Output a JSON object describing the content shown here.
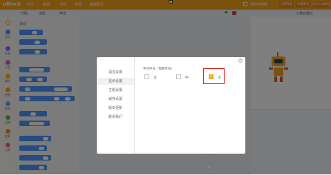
{
  "app": {
    "logo_text": "uBlock"
  },
  "topbar": {
    "menus": [
      "文件",
      "编辑",
      "项目",
      "教程",
      "编程模式"
    ],
    "save_cloud_label": "保存到电脑",
    "login_label": "立即登录",
    "register_label": "注册账号",
    "python_label": "Python编程"
  },
  "tabs": {
    "code": "代码",
    "costume": "造型",
    "sound": "声音"
  },
  "categories": [
    {
      "label": "运动",
      "color": "#4c97ff"
    },
    {
      "label": "外观",
      "color": "#9966ff"
    },
    {
      "label": "声音",
      "color": "#cf63cf"
    },
    {
      "label": "事件",
      "color": "#ffbf00"
    },
    {
      "label": "控制",
      "color": "#ffab19"
    },
    {
      "label": "侦测",
      "color": "#5cb1d6"
    },
    {
      "label": "运算",
      "color": "#59c059"
    },
    {
      "label": "变量",
      "color": "#ff8c1a"
    },
    {
      "label": "自制",
      "color": "#ff6680"
    }
  ],
  "palette": {
    "heading": "运动"
  },
  "stage": {
    "display_mode_label": "小舞台模式"
  },
  "dialog": {
    "menu": [
      "语言设置",
      "显示设置",
      "主题设置",
      "缓存设置",
      "版本更新",
      "联系我们"
    ],
    "active_index": 1,
    "section_title": "字体字号（需要生效）",
    "options": [
      {
        "label": "大",
        "checked": false
      },
      {
        "label": "中",
        "checked": false
      },
      {
        "label": "小",
        "checked": true
      }
    ],
    "check_glyph": "✓",
    "close_glyph": "×"
  }
}
